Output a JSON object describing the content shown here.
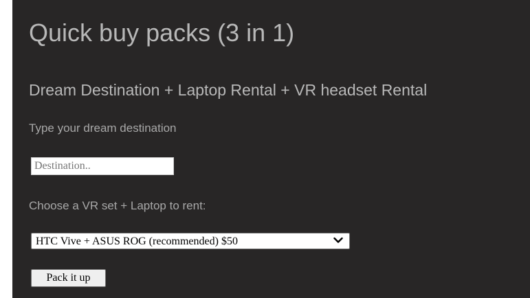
{
  "page": {
    "title": "Quick buy packs (3 in 1)",
    "subtitle": "Dream Destination + Laptop Rental + VR headset Rental"
  },
  "destination": {
    "label": "Type your dream destination",
    "placeholder": "Destination..",
    "value": ""
  },
  "vr_select": {
    "label": "Choose a VR set + Laptop to rent:",
    "selected": "HTC Vive + ASUS ROG (recommended) $50",
    "icon": "chevron-down-icon"
  },
  "submit": {
    "label": "Pack it up"
  },
  "colors": {
    "panel_background": "#282626",
    "text": "#b8b8b8"
  }
}
